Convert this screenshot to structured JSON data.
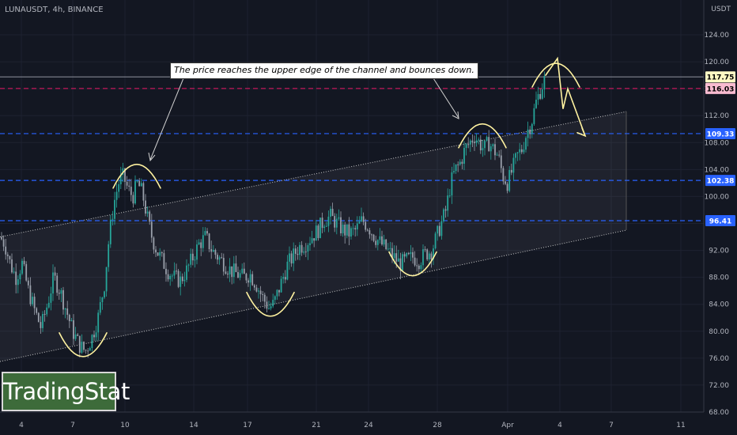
{
  "header": {
    "symbol": "LUNAUSDT, 4h, BINANCE",
    "currency": "USDT"
  },
  "logo": {
    "text": "TradingStat"
  },
  "annotation": {
    "text": "The price reaches the upper edge of the channel and bounces down."
  },
  "chart_data": {
    "type": "candlestick",
    "title": "LUNAUSDT, 4h, BINANCE",
    "ylabel": "USDT",
    "ylim": [
      68,
      126
    ],
    "y_ticks": [
      68,
      72,
      76,
      80,
      84,
      88,
      92,
      96,
      100,
      104,
      108,
      112,
      116,
      120,
      124
    ],
    "x_tick_labels": [
      "4",
      "7",
      "10",
      "14",
      "17",
      "21",
      "24",
      "28",
      "Apr",
      "4",
      "7",
      "11"
    ],
    "price_levels": [
      {
        "value": 117.75,
        "label": "117.75",
        "color": "#787b86",
        "style": "solid",
        "badge_bg": "#fff9c4",
        "badge_fg": "#000000"
      },
      {
        "value": 116.03,
        "label": "116.03",
        "color": "#c2185b",
        "style": "dashed",
        "badge_bg": "#f8bbd0",
        "badge_fg": "#000000"
      },
      {
        "value": 109.33,
        "label": "109.33",
        "color": "#2962ff",
        "style": "dashed",
        "badge_bg": "#2962ff",
        "badge_fg": "#ffffff"
      },
      {
        "value": 102.38,
        "label": "102.38",
        "color": "#2962ff",
        "style": "dashed",
        "badge_bg": "#2962ff",
        "badge_fg": "#ffffff"
      },
      {
        "value": 96.41,
        "label": "96.41",
        "color": "#2962ff",
        "style": "dashed",
        "badge_bg": "#2962ff",
        "badge_fg": "#ffffff"
      }
    ],
    "channel": {
      "upper": [
        {
          "x": "4",
          "price": 94
        },
        {
          "x": "8",
          "price": 112.6
        }
      ],
      "lower": [
        {
          "x": "4",
          "price": 75.5
        },
        {
          "x": "8",
          "price": 95
        }
      ]
    },
    "price_path": [
      [
        0,
        94
      ],
      [
        6,
        93
      ],
      [
        13,
        90
      ],
      [
        20,
        88
      ],
      [
        28,
        90
      ],
      [
        36,
        86
      ],
      [
        44,
        83
      ],
      [
        52,
        80.5
      ],
      [
        60,
        84
      ],
      [
        68,
        88
      ],
      [
        76,
        86
      ],
      [
        84,
        83
      ],
      [
        92,
        80
      ],
      [
        100,
        78
      ],
      [
        108,
        77
      ],
      [
        116,
        79
      ],
      [
        124,
        82
      ],
      [
        132,
        87
      ],
      [
        138,
        94
      ],
      [
        144,
        99
      ],
      [
        150,
        102
      ],
      [
        156,
        103
      ],
      [
        162,
        101
      ],
      [
        168,
        100
      ],
      [
        174,
        102
      ],
      [
        180,
        100.5
      ],
      [
        186,
        97
      ],
      [
        192,
        94
      ],
      [
        198,
        92
      ],
      [
        205,
        90.5
      ],
      [
        212,
        89
      ],
      [
        220,
        88
      ],
      [
        228,
        87.5
      ],
      [
        236,
        89
      ],
      [
        244,
        91
      ],
      [
        252,
        93
      ],
      [
        260,
        94
      ],
      [
        268,
        92
      ],
      [
        276,
        91
      ],
      [
        284,
        90
      ],
      [
        292,
        89
      ],
      [
        300,
        88.5
      ],
      [
        308,
        88
      ],
      [
        316,
        88.5
      ],
      [
        324,
        87
      ],
      [
        332,
        85
      ],
      [
        340,
        83.5
      ],
      [
        346,
        84
      ],
      [
        352,
        86
      ],
      [
        358,
        88
      ],
      [
        364,
        90
      ],
      [
        370,
        91
      ],
      [
        378,
        92.5
      ],
      [
        386,
        93
      ],
      [
        394,
        94
      ],
      [
        402,
        95
      ],
      [
        410,
        96.5
      ],
      [
        418,
        97
      ],
      [
        426,
        96
      ],
      [
        434,
        95
      ],
      [
        442,
        94.5
      ],
      [
        450,
        95
      ],
      [
        458,
        96.5
      ],
      [
        466,
        95.5
      ],
      [
        474,
        94
      ],
      [
        482,
        93
      ],
      [
        490,
        92
      ],
      [
        498,
        91
      ],
      [
        506,
        90
      ],
      [
        514,
        90.5
      ],
      [
        522,
        91
      ],
      [
        530,
        90.5
      ],
      [
        538,
        91.5
      ],
      [
        546,
        92
      ],
      [
        552,
        94
      ],
      [
        558,
        96
      ],
      [
        564,
        98
      ],
      [
        570,
        102
      ],
      [
        576,
        104
      ],
      [
        582,
        105
      ],
      [
        588,
        107
      ],
      [
        594,
        108
      ],
      [
        600,
        109
      ],
      [
        606,
        108
      ],
      [
        612,
        107
      ],
      [
        618,
        108
      ],
      [
        624,
        107
      ],
      [
        630,
        106
      ],
      [
        636,
        103
      ],
      [
        642,
        102
      ],
      [
        648,
        104
      ],
      [
        654,
        106
      ],
      [
        660,
        107
      ],
      [
        666,
        109.5
      ],
      [
        672,
        111
      ],
      [
        678,
        114
      ],
      [
        684,
        116
      ],
      [
        690,
        117.75
      ]
    ],
    "drawn_curves": [
      {
        "shape": "trough",
        "x_center": 105,
        "price": 76
      },
      {
        "shape": "peak",
        "x_center": 173,
        "price": 105
      },
      {
        "shape": "trough",
        "x_center": 342,
        "price": 82
      },
      {
        "shape": "trough",
        "x_center": 522,
        "price": 88
      },
      {
        "shape": "peak",
        "x_center": 610,
        "price": 111
      },
      {
        "shape": "peak",
        "x_center": 703,
        "price": 120
      }
    ],
    "forecast_path": [
      [
        690,
        118
      ],
      [
        705,
        120.5
      ],
      [
        712,
        113
      ],
      [
        718,
        116
      ],
      [
        740,
        109
      ]
    ]
  },
  "colors": {
    "background": "#131722",
    "grid": "#1e2230",
    "up": "#26a69a",
    "down": "#9aa0ab",
    "channel_fill": "rgba(255,255,255,0.05)",
    "channel_line": "#c8c8c8",
    "drawing": "#fff2a0",
    "axis_text": "#b2b5be"
  }
}
